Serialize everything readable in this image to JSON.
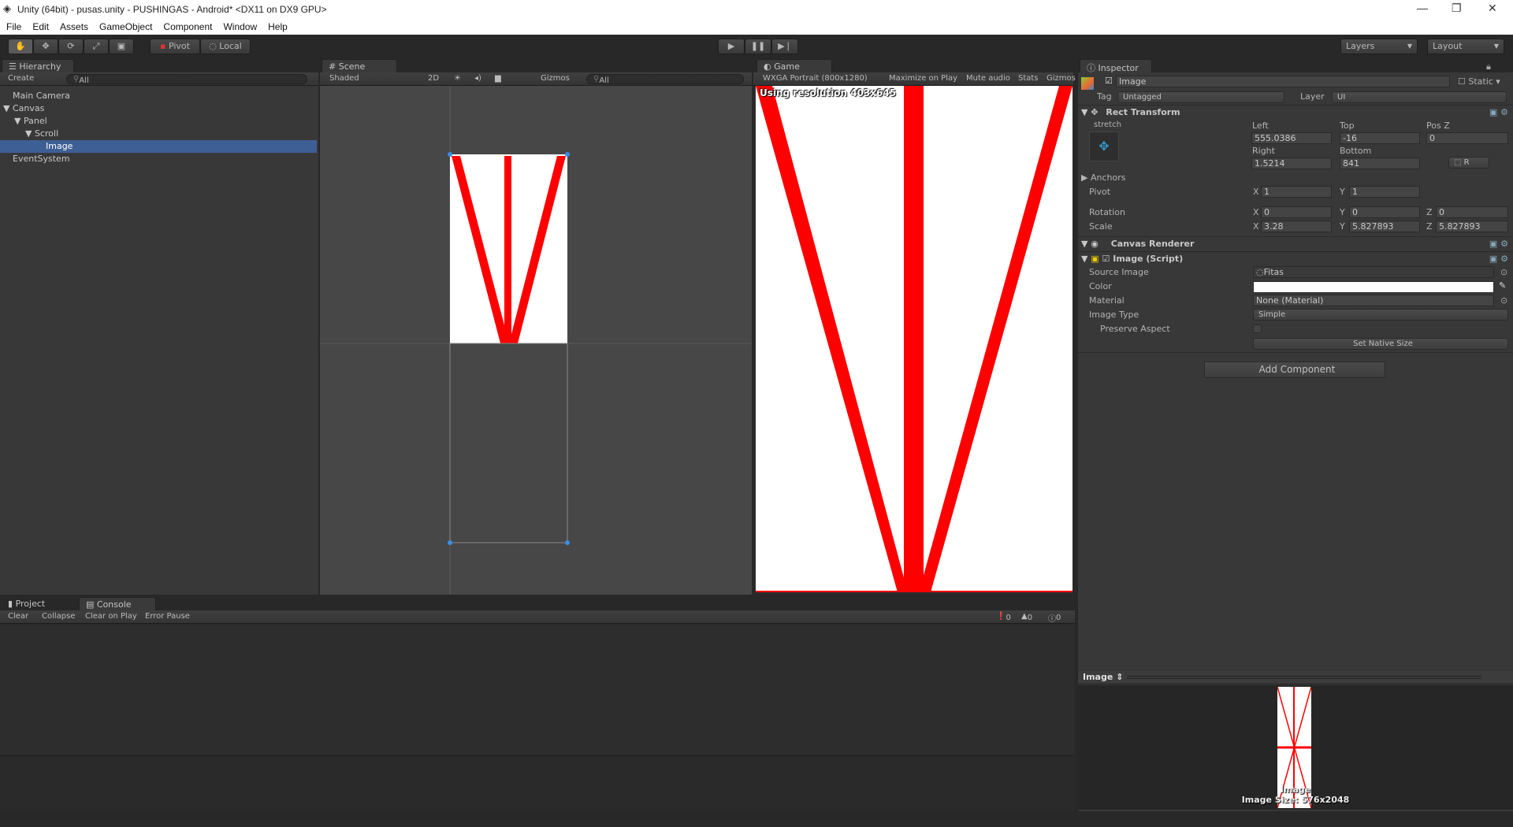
{
  "window": {
    "title": "Unity (64bit) - pusas.unity - PUSHINGAS - Android* <DX11 on DX9 GPU>"
  },
  "menu": [
    "File",
    "Edit",
    "Assets",
    "GameObject",
    "Component",
    "Window",
    "Help"
  ],
  "toolbar": {
    "pivot": "Pivot",
    "local": "Local",
    "layers": "Layers",
    "layout": "Layout"
  },
  "hierarchy": {
    "tab": "Hierarchy",
    "create": "Create",
    "search": "All",
    "items": [
      {
        "label": "Main Camera",
        "depth": 0
      },
      {
        "label": "Canvas",
        "depth": 0,
        "expanded": true
      },
      {
        "label": "Panel",
        "depth": 1,
        "expanded": true
      },
      {
        "label": "Scroll",
        "depth": 2,
        "expanded": true
      },
      {
        "label": "Image",
        "depth": 3,
        "selected": true
      },
      {
        "label": "EventSystem",
        "depth": 0
      }
    ]
  },
  "scene": {
    "tab": "Scene",
    "shading": "Shaded",
    "mode2d": "2D",
    "gizmos": "Gizmos",
    "search": "All"
  },
  "game": {
    "tab": "Game",
    "resolution": "WXGA Portrait (800x1280)",
    "maximize": "Maximize on Play",
    "mute": "Mute audio",
    "stats": "Stats",
    "gizmos": "Gizmos",
    "overlay": "Using resolution 403x645"
  },
  "inspector": {
    "tab": "Inspector",
    "object_name": "Image",
    "static": "Static",
    "tag_label": "Tag",
    "tag": "Untagged",
    "layer_label": "Layer",
    "layer": "UI",
    "rect": {
      "title": "Rect Transform",
      "anchor_preset": "stretch",
      "left_label": "Left",
      "top_label": "Top",
      "posz_label": "Pos Z",
      "left": "555.0386",
      "top": "-16",
      "posz": "0",
      "right_label": "Right",
      "bottom_label": "Bottom",
      "right": "1.5214",
      "bottom": "841",
      "r_button": "R",
      "anchors": "Anchors",
      "pivot": "Pivot",
      "pivot_x": "1",
      "pivot_y": "1",
      "rotation": "Rotation",
      "rot_x": "0",
      "rot_y": "0",
      "rot_z": "0",
      "scale": "Scale",
      "scale_x": "3.28",
      "scale_y": "5.827893",
      "scale_z": "5.827893"
    },
    "canvas_renderer": "Canvas Renderer",
    "image": {
      "title": "Image (Script)",
      "source_label": "Source Image",
      "source": "Fitas",
      "color_label": "Color",
      "color": "#ffffff",
      "material_label": "Material",
      "material": "None (Material)",
      "type_label": "Image Type",
      "type": "Simple",
      "preserve_label": "Preserve Aspect",
      "native": "Set Native Size"
    },
    "add_component": "Add Component",
    "preview": {
      "title": "Image",
      "name": "Image",
      "size": "Image Size: 576x2048"
    }
  },
  "bottom": {
    "tabs": [
      "Project",
      "Console"
    ],
    "buttons": [
      "Clear",
      "Collapse",
      "Clear on Play",
      "Error Pause"
    ],
    "errors": "0",
    "warnings": "0",
    "messages": "0"
  },
  "colors": {
    "selection": "#3e5f96",
    "red": "#ff0000"
  }
}
